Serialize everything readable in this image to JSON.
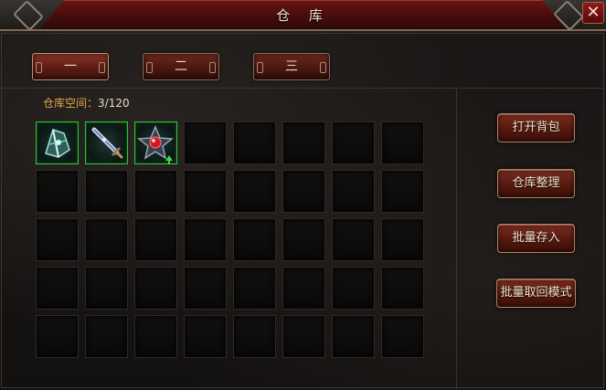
{
  "window": {
    "title": "仓 库",
    "close_label": "✕"
  },
  "tabs": [
    {
      "label": "一",
      "active": true
    },
    {
      "label": "二",
      "active": false
    },
    {
      "label": "三",
      "active": false
    }
  ],
  "storage": {
    "label": "仓库空间：",
    "value": "3/120"
  },
  "slots": {
    "rows": 5,
    "columns": 8,
    "items": [
      {
        "icon": "armor-shard-icon",
        "upgrade": false
      },
      {
        "icon": "sword-icon",
        "upgrade": false
      },
      {
        "icon": "red-gem-star-icon",
        "upgrade": true
      }
    ]
  },
  "buttons": {
    "open_bag": "打开背包",
    "sort_storage": "仓库整理",
    "batch_deposit": "批量存入",
    "batch_withdraw_mode": "批量取回模式"
  },
  "colors": {
    "accent_gold": "#e0a64a",
    "item_border_green": "#33c040",
    "title_red": "#6a1512"
  }
}
